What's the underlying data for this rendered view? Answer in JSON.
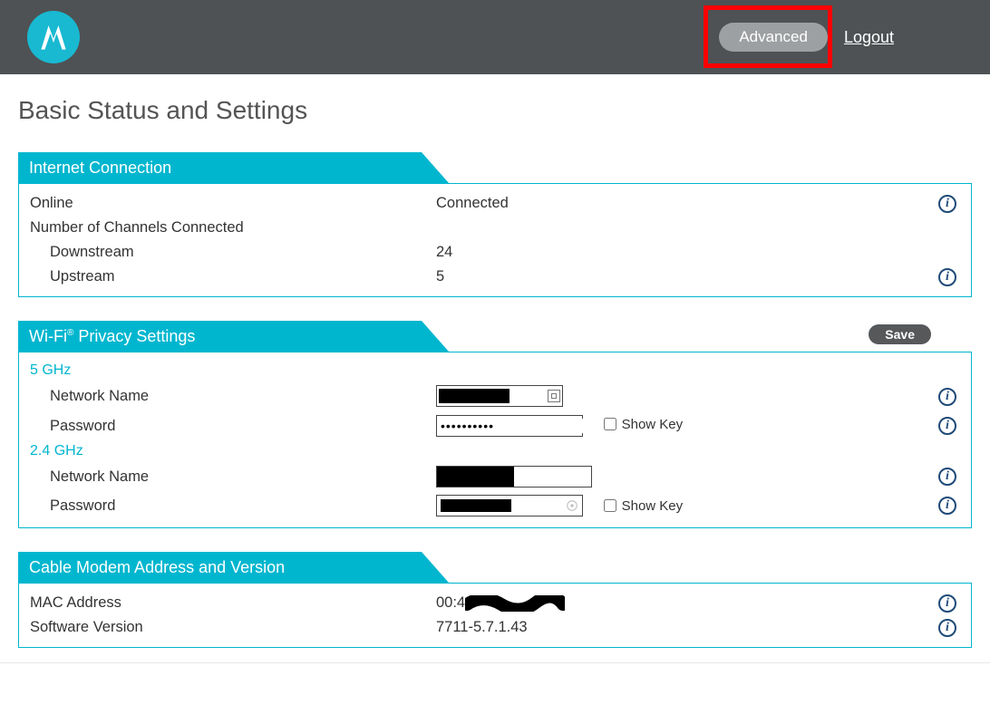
{
  "header": {
    "advanced_label": "Advanced",
    "logout_label": "Logout"
  },
  "page_title": "Basic Status and Settings",
  "sections": {
    "internet": {
      "title": "Internet Connection",
      "online_label": "Online",
      "online_value": "Connected",
      "channels_label": "Number of Channels Connected",
      "downstream_label": "Downstream",
      "downstream_value": "24",
      "upstream_label": "Upstream",
      "upstream_value": "5"
    },
    "wifi": {
      "title_prefix": "Wi-Fi",
      "title_suffix": " Privacy Settings",
      "save_label": "Save",
      "band5_label": "5 GHz",
      "band24_label": "2.4 GHz",
      "network_name_label": "Network Name",
      "password_label": "Password",
      "showkey_label": "Show Key",
      "ssid5_value": "████████",
      "password5_value": "••••••••••",
      "ssid24_value": "████",
      "password24_value": "████████"
    },
    "modem": {
      "title": "Cable Modem Address and Version",
      "mac_label": "MAC Address",
      "mac_value_visible_prefix": "00:4",
      "software_label": "Software Version",
      "software_value": "7711-5.7.1.43"
    }
  }
}
